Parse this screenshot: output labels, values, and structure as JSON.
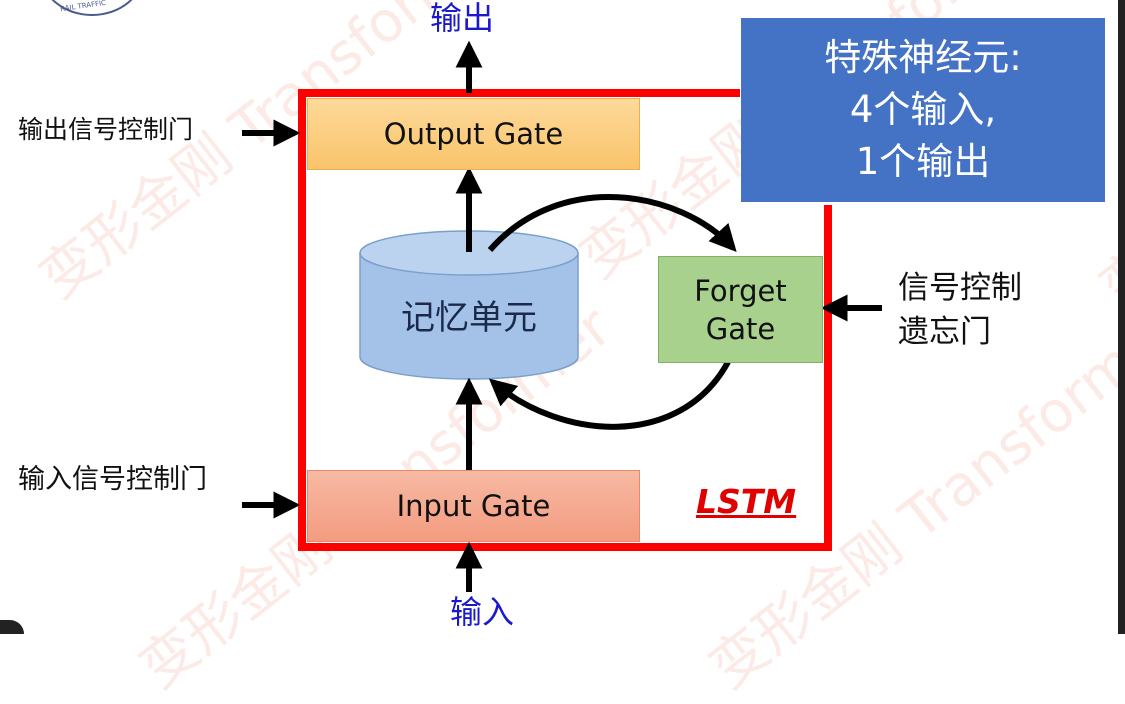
{
  "watermark_text": "变形金刚 Transformer",
  "output_label": "输出",
  "input_label": "输入",
  "output_gate_control_label": "输出信号控制门",
  "input_gate_control_label": "输入信号控制门",
  "forget_gate_control_label": "信号控制\n遗忘门",
  "gates": {
    "output": "Output Gate",
    "input": "Input Gate",
    "forget": "Forget\nGate"
  },
  "memory_cell": "记忆单元",
  "special_neuron": {
    "line1": "特殊神经元:",
    "line2": "4个输入,",
    "line3": "1个输出"
  },
  "lstm_label": "LSTM",
  "colors": {
    "frame": "#ff0000",
    "arrow": "#000000",
    "special_box": "#4472c4",
    "io_text": "#1a1acc"
  }
}
